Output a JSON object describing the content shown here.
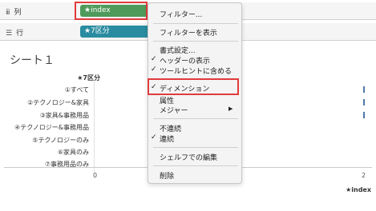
{
  "shelves": {
    "columns": {
      "label": "列",
      "pill": "★index"
    },
    "rows": {
      "label": "行",
      "pill": "★7区分"
    }
  },
  "sheet": {
    "title": "シート１",
    "header": "★7区分",
    "rows": [
      "①すべて",
      "②テクノロジー&家具",
      "③家具&事務用品",
      "④テクノロジー&事務用品",
      "⑤テクノロジーのみ",
      "⑥家具のみ",
      "⑦事務用品のみ"
    ],
    "axis": {
      "ticks": [
        "0",
        "2"
      ],
      "title": "★index"
    }
  },
  "menu": {
    "filter": "フィルター...",
    "show_filter": "フィルターを表示",
    "format": "書式設定...",
    "show_header": "ヘッダーの表示",
    "include_tooltip": "ツールヒントに含める",
    "dimension": "ディメンション",
    "attribute": "属性",
    "measure": "メジャー",
    "discrete": "不連続",
    "continuous": "連続",
    "edit_in_shelf": "シェルフでの編集",
    "remove": "削除"
  },
  "colors": {
    "pill_green": "#4e9a5a",
    "pill_blue": "#2a8ca0",
    "highlight": "#e23b3b"
  }
}
